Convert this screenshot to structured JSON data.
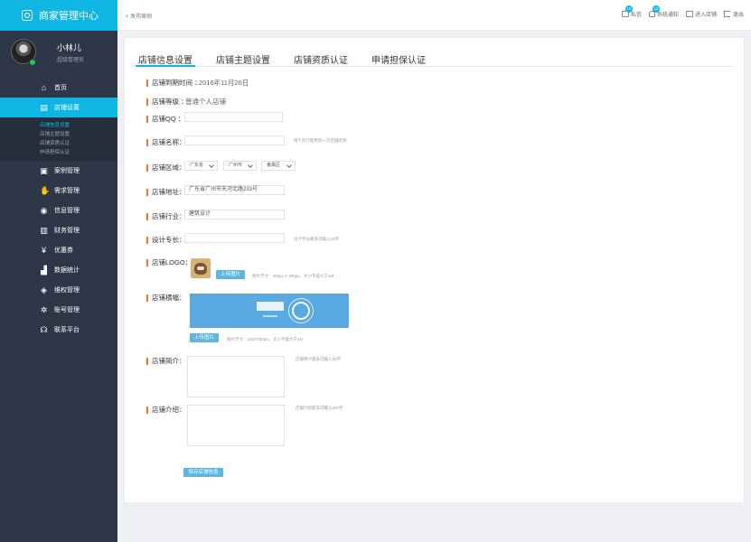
{
  "app": {
    "title": "商家管理中心"
  },
  "user": {
    "name": "小林儿",
    "role": "超级管理员"
  },
  "sidebar": {
    "items": [
      {
        "label": "首页",
        "icon": "home-icon"
      },
      {
        "label": "店铺设置",
        "icon": "store-icon",
        "active": true,
        "sub": [
          "店铺信息设置",
          "店铺主题设置",
          "店铺资质认证",
          "申请担保认证"
        ]
      },
      {
        "label": "案例管理",
        "icon": "case-icon"
      },
      {
        "label": "需求管理",
        "icon": "hand-icon"
      },
      {
        "label": "信息管理",
        "icon": "message-icon"
      },
      {
        "label": "财务管理",
        "icon": "finance-icon"
      },
      {
        "label": "优惠券",
        "icon": "coupon-icon"
      },
      {
        "label": "数据统计",
        "icon": "chart-icon"
      },
      {
        "label": "维权管理",
        "icon": "shield-icon"
      },
      {
        "label": "账号管理",
        "icon": "gear-icon"
      },
      {
        "label": "联系平台",
        "icon": "headset-icon"
      }
    ]
  },
  "topbar": {
    "publish": "+ 发布案例",
    "links": [
      {
        "label": "私信",
        "badge": "10"
      },
      {
        "label": "系统通知",
        "badge": "12"
      },
      {
        "label": "进入店铺",
        "badge": ""
      },
      {
        "label": "退出",
        "badge": ""
      }
    ]
  },
  "tabs": [
    "店铺信息设置",
    "店铺主题设置",
    "店铺资质认证",
    "申请担保认证"
  ],
  "form": {
    "expire_label": "店铺到期时间 ：",
    "expire_value": "2016年11月26日",
    "level_label": "店铺等级 ：",
    "level_value": "普通个人店铺",
    "qq_label": "店铺QQ ：",
    "qq_value": "",
    "name_label": "店铺名称：",
    "name_value": "",
    "name_hint": "每个月只能更改一次店铺名称",
    "region_label": "店铺区域：",
    "province": "广东省",
    "city": "广州市",
    "district": "番禺区",
    "address_label": "店铺地址：",
    "address_value": "广东省广州市天河北路233号",
    "industry_label": "店铺行业：",
    "industry_value": "建筑设计",
    "specialty_label": "设计专长：",
    "specialty_value": "",
    "specialty_hint": "设计专长最多可输入15字",
    "logo_label": "店铺LOGO：",
    "logo_upload": "上传图片",
    "logo_hint": "图片尺寸：300px X 300px，大小不能大于1M",
    "banner_label": "店铺横幅：",
    "banner_upload": "上传图片",
    "banner_hint": "图片尺寸：1920*304px，大小不能大于1M",
    "intro_label": "店铺简介：",
    "intro_hint": "店铺简介最多可输入30字",
    "detail_label": "店铺介绍：",
    "detail_hint": "店铺介绍最多可输入500字",
    "save_label": "保存店铺信息"
  }
}
